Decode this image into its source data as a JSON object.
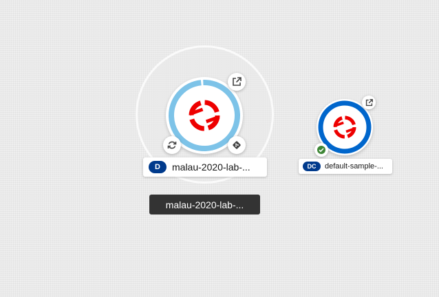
{
  "topology": {
    "groups": [
      {
        "node": {
          "badge": "D",
          "label": "malau-2020-lab-...",
          "icon": "openshift-icon",
          "status_ring_color": "#7dc3e8",
          "decorators": [
            "external-link-icon",
            "refresh-icon",
            "git-icon"
          ]
        },
        "tooltip": "malau-2020-lab-..."
      }
    ],
    "nodes": [
      {
        "badge": "DC",
        "label": "default-sample-...",
        "icon": "openshift-icon",
        "status_ring_color": "#0066cc",
        "decorators": [
          "external-link-icon",
          "success-check-icon"
        ]
      }
    ]
  },
  "colors": {
    "brand_red": "#ee0000",
    "badge_blue": "#003a8c",
    "success_green": "#3e8635"
  }
}
